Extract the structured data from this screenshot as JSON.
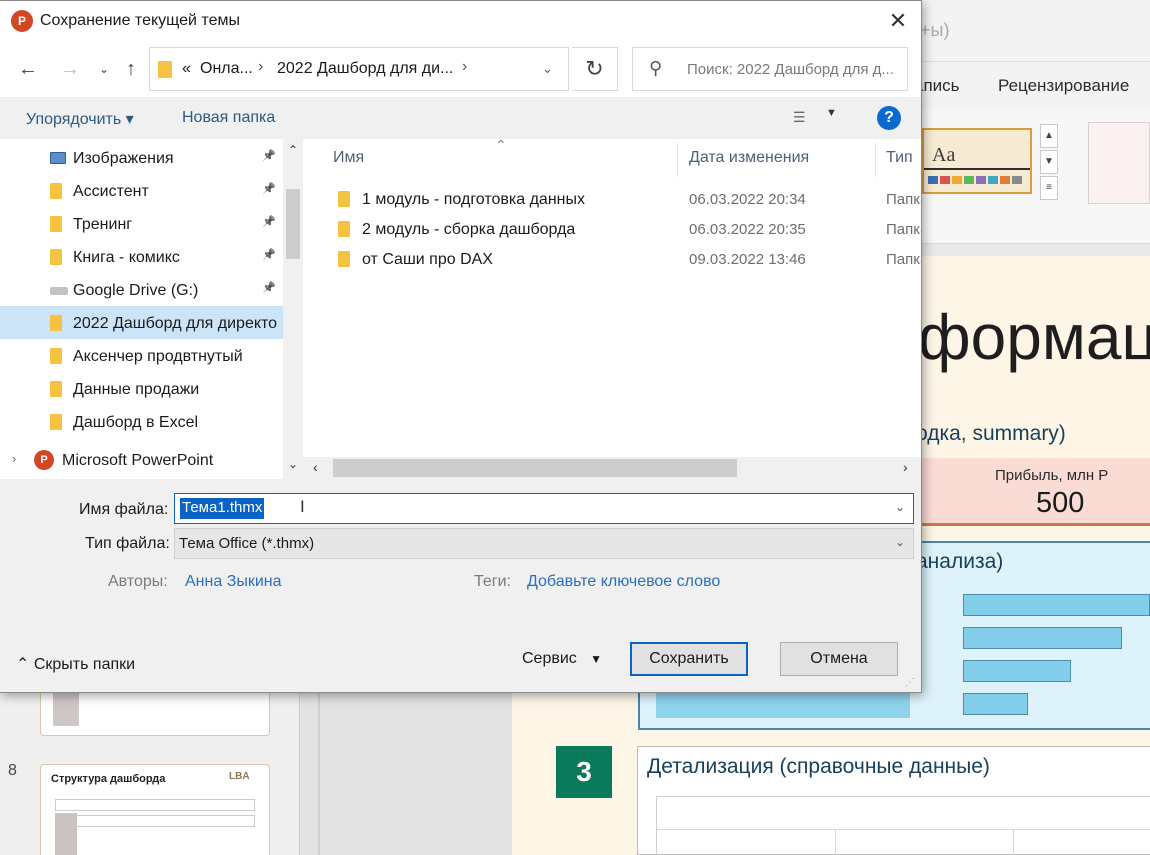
{
  "dialog": {
    "title": "Сохранение текущей темы",
    "app_icon": "powerpoint-logo",
    "close": "✕"
  },
  "address": {
    "overflow": "«",
    "crumb1": "Онла...",
    "crumb2": "2022 Дашборд для ди...",
    "separator": "›"
  },
  "search": {
    "placeholder": "Поиск: 2022 Дашборд для д..."
  },
  "toolbar": {
    "organize": "Упорядочить ▾",
    "new_folder": "Новая папка",
    "help": "?"
  },
  "nav_items": [
    {
      "label": "Изображения",
      "icon": "pictures-icon",
      "pinned": true
    },
    {
      "label": "Ассистент",
      "icon": "folder-icon",
      "pinned": true
    },
    {
      "label": "Тренинг",
      "icon": "folder-icon",
      "pinned": true
    },
    {
      "label": "Книга - комикс",
      "icon": "folder-icon",
      "pinned": true
    },
    {
      "label": "Google Drive (G:)",
      "icon": "drive-icon",
      "pinned": true
    },
    {
      "label": "2022 Дашборд для директо",
      "icon": "folder-icon",
      "selected": true
    },
    {
      "label": "Аксенчер продвтнутый",
      "icon": "folder-icon"
    },
    {
      "label": "Данные продажи",
      "icon": "folder-icon"
    },
    {
      "label": "Дашборд в Excel",
      "icon": "folder-icon"
    },
    {
      "label": "Microsoft PowerPoint",
      "icon": "powerpoint-icon"
    }
  ],
  "columns": {
    "name": "Имя",
    "date": "Дата изменения",
    "type": "Тип"
  },
  "files": [
    {
      "name": "1 модуль - подготовка данных",
      "date": "06.03.2022 20:34",
      "type": "Папка"
    },
    {
      "name": "2 модуль - сборка дашборда",
      "date": "06.03.2022 20:35",
      "type": "Папка"
    },
    {
      "name": "от Саши про DAX",
      "date": "09.03.2022 13:46",
      "type": "Папка"
    }
  ],
  "form": {
    "filename_label": "Имя файла:",
    "filename_value": "Тема1.thmx",
    "filetype_label": "Тип файла:",
    "filetype_value": "Тема Office (*.thmx)",
    "authors_label": "Авторы:",
    "authors_value": "Анна Зыкина",
    "tags_label": "Теги:",
    "tags_value": "Добавьте ключевое слово"
  },
  "footer": {
    "hide_folders": "⌃ Скрыть папки",
    "service": "Сервис",
    "save": "Сохранить",
    "cancel": "Отмена"
  },
  "background": {
    "title_fragment": "+ы)",
    "tab_insert_partial": "апись",
    "tab_review": "Рецензирование",
    "theme_preview_text": "Aa",
    "slide_title_partial": "формац",
    "section1": "одка, summary)",
    "kpi_label": "Прибыль, млн Р",
    "kpi_value": "500",
    "section2": "анализа)",
    "badge": "3",
    "section3": "Детализация (справочные данные)",
    "slide_number": "8",
    "thumb_title": "Структура дашборда",
    "thumb_logo": "LBA",
    "bar_values": [
      1.0,
      0.85,
      0.58,
      0.35
    ],
    "theme_swatches": [
      "#3b6fb6",
      "#d9534f",
      "#f0a830",
      "#5cb85c",
      "#8e6fb5",
      "#3fa9c4",
      "#e07b39",
      "#8a8a8a"
    ]
  }
}
